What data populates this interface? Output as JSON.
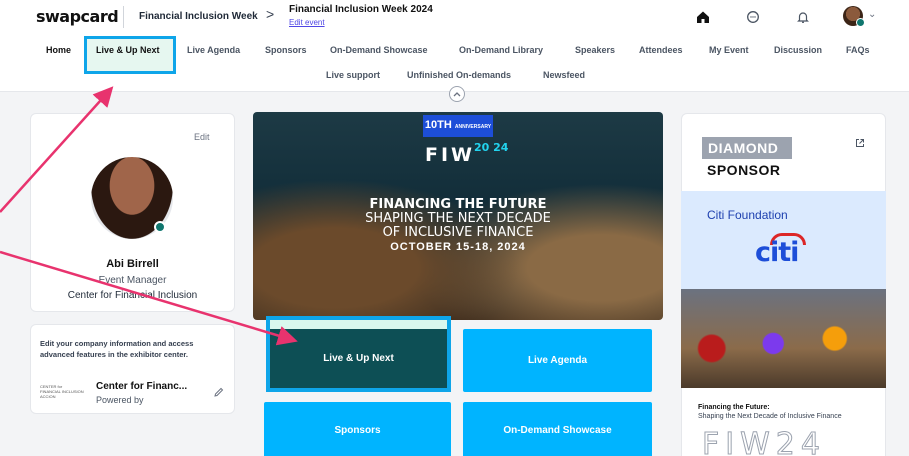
{
  "header": {
    "logo": "swapcard",
    "breadcrumb_event": "Financial Inclusion Week",
    "breadcrumb_chevron": ">",
    "current_event": "Financial Inclusion Week 2024",
    "edit_event": "Edit event",
    "icons": [
      "home-icon",
      "chat-icon",
      "bell-icon"
    ],
    "avatar_chevron": "⌄"
  },
  "nav": {
    "row1": [
      "Home",
      "Live & Up Next",
      "Live Agenda",
      "Sponsors",
      "On-Demand Showcase",
      "On-Demand Library",
      "Speakers",
      "Attendees",
      "My Event",
      "Discussion",
      "FAQs"
    ],
    "row2": [
      "Live support",
      "Unfinished On-demands",
      "Newsfeed"
    ],
    "active": "Live & Up Next"
  },
  "profile": {
    "edit": "Edit",
    "name": "Abi Birrell",
    "role": "Event Manager",
    "organization": "Center for Financial Inclusion"
  },
  "exhibitor": {
    "text": "Edit your company information and access advanced features in the exhibitor center.",
    "logo_text": "CENTER for FINANCIAL INCLUSION ACCION",
    "name": "Center for Financ...",
    "sub": "Powered by"
  },
  "banner": {
    "anniversary": "10TH",
    "anniversary_sub": "ANNIVERSARY",
    "logo": "FIW",
    "logo_year": "20 24",
    "line1": "FINANCING THE FUTURE",
    "line2": "SHAPING THE NEXT DECADE",
    "line3": "OF INCLUSIVE FINANCE",
    "dates": "OCTOBER 15-18, 2024"
  },
  "tiles": {
    "live": "Live & Up Next",
    "agenda": "Live Agenda",
    "sponsors": "Sponsors",
    "showcase": "On-Demand Showcase"
  },
  "sponsor": {
    "tier": "DIAMOND",
    "label": "SPONSOR",
    "name": "Citi Foundation",
    "logo": "citi",
    "caption1": "Financing the Future:",
    "caption2": "Shaping the Next Decade of Inclusive Finance",
    "fiw": "FIW24"
  },
  "colors": {
    "accent": "#00b4ff",
    "highlight": "#0ea5e9",
    "arrow": "#e8336e",
    "tile_active": "#0d4f55"
  }
}
